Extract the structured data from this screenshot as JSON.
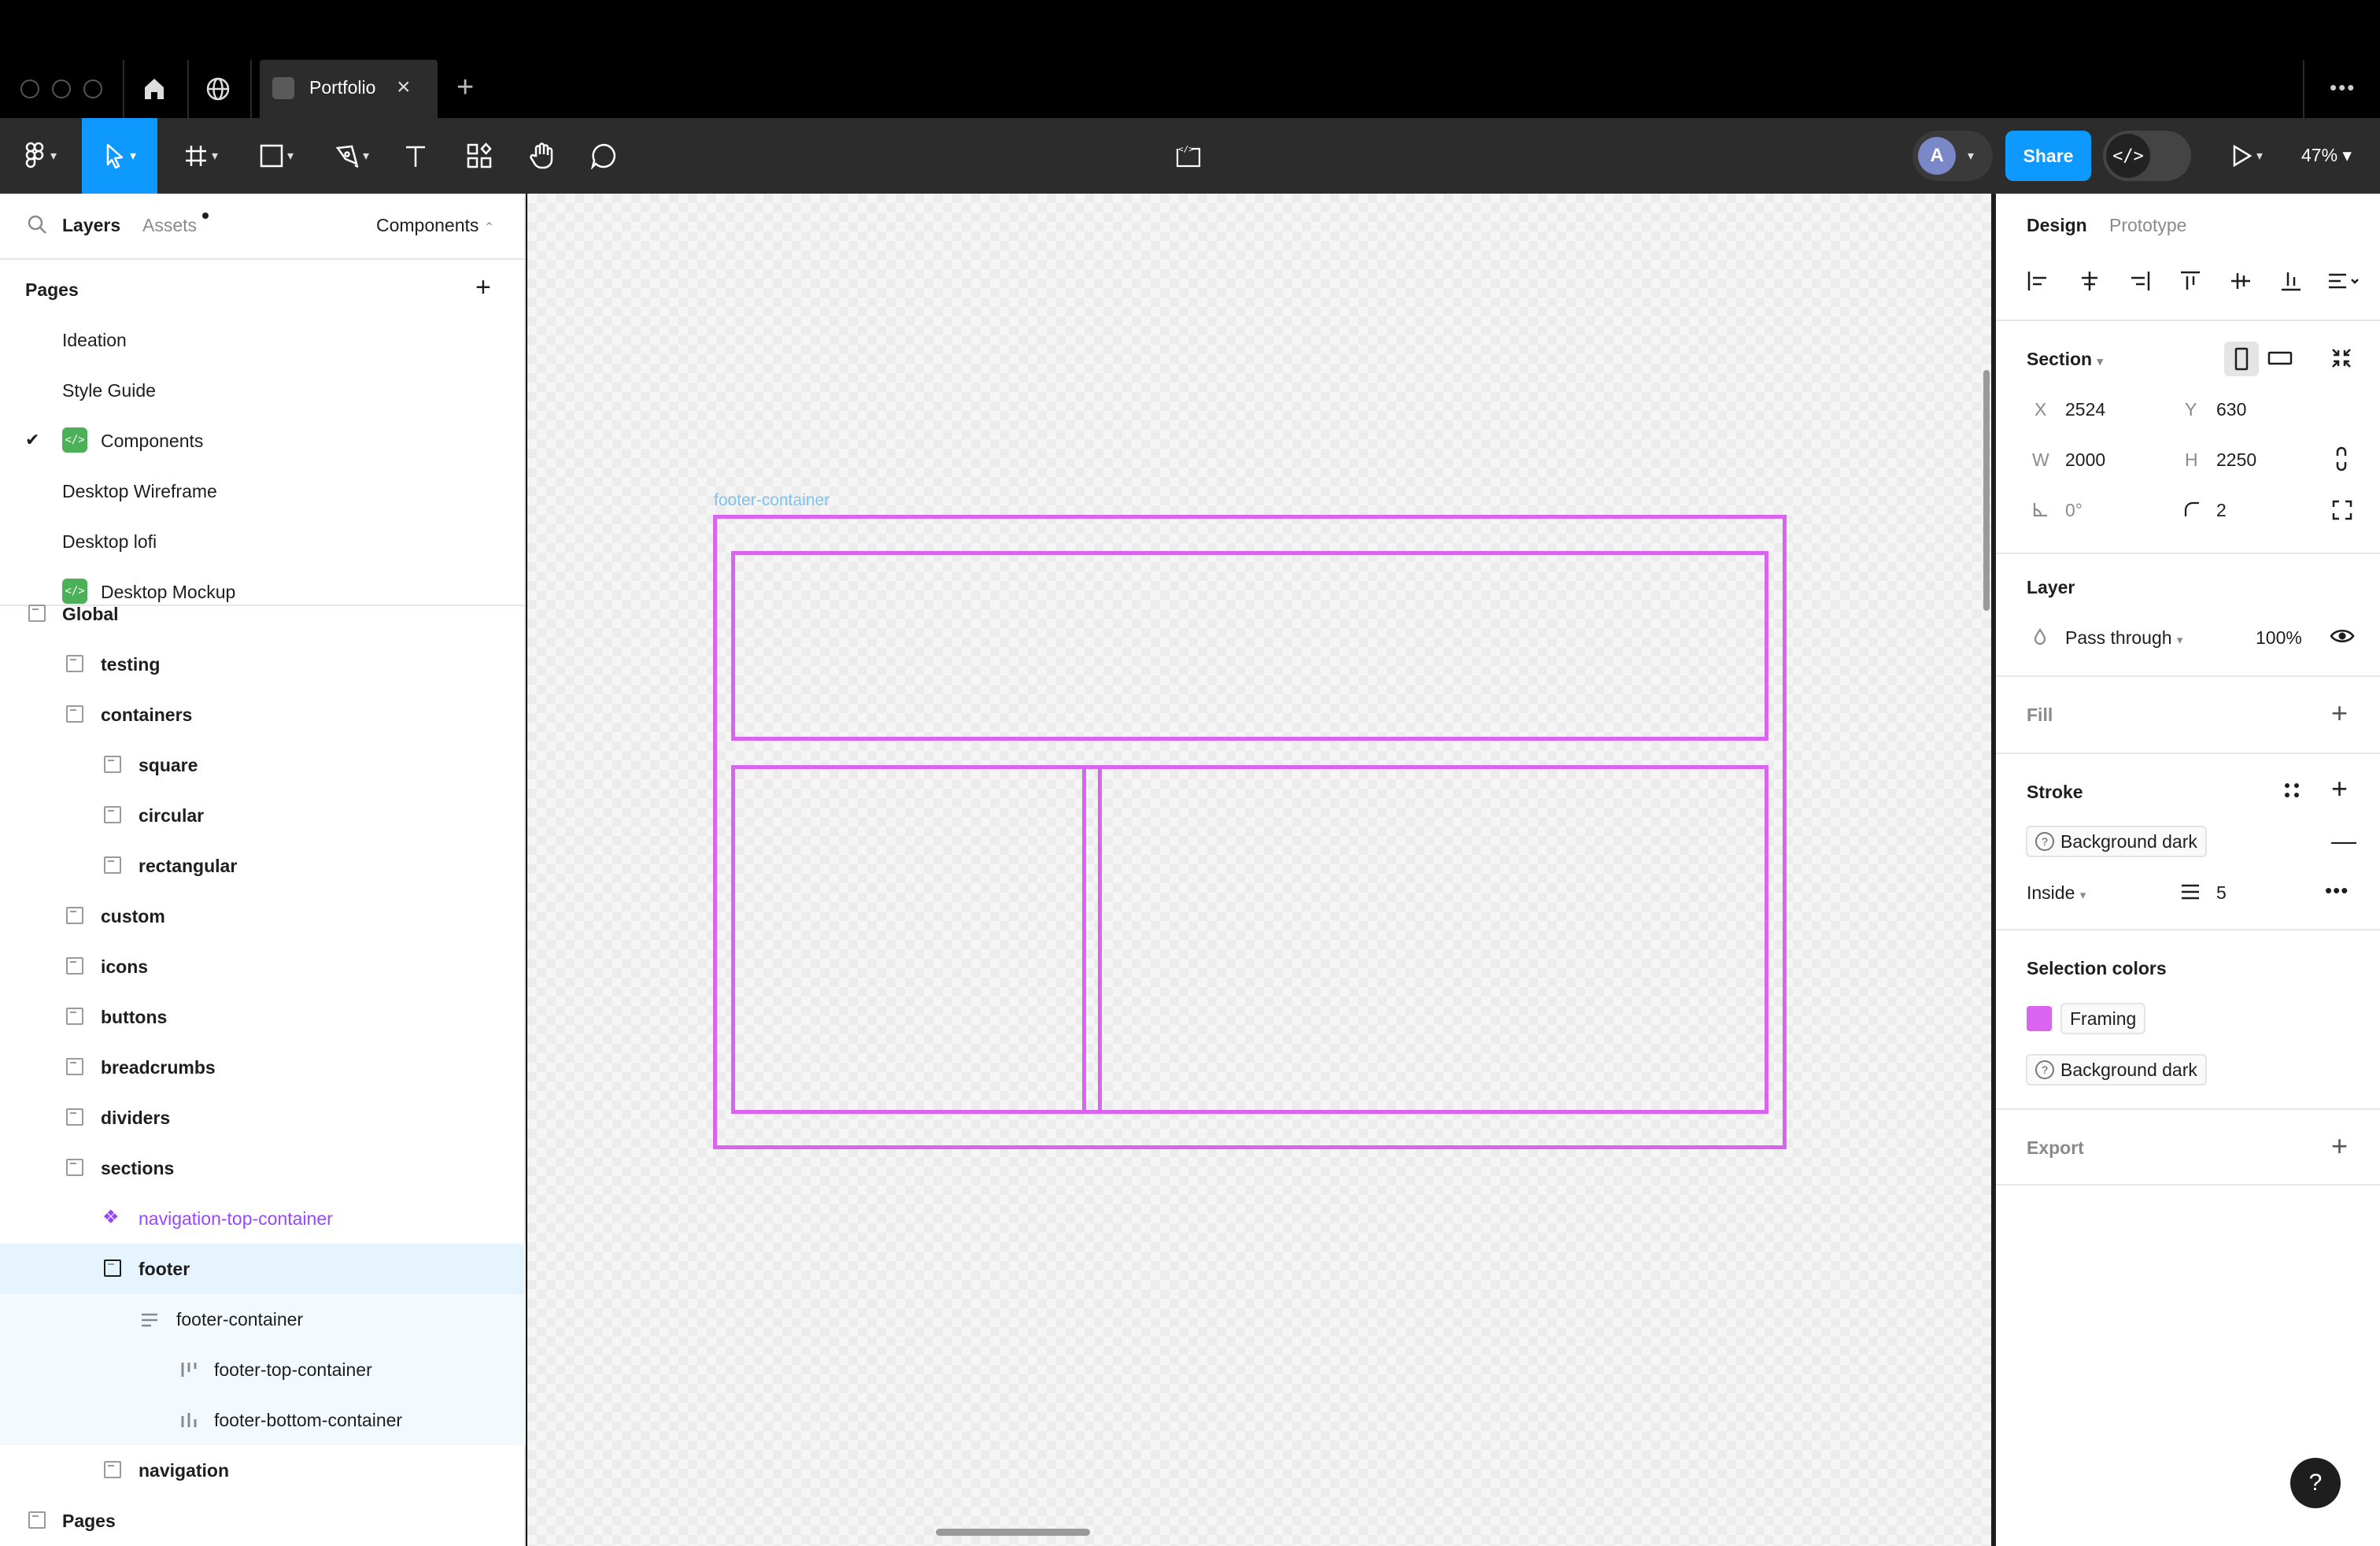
{
  "window": {
    "tab_title": "Portfolio"
  },
  "toolbar": {
    "share_label": "Share",
    "zoom": "47%",
    "avatar_initial": "A",
    "devmode_glyph": "</>"
  },
  "left_panel": {
    "tabs": {
      "layers": "Layers",
      "assets": "Assets"
    },
    "page_selector": "Components",
    "pages_header": "Pages",
    "pages": [
      {
        "label": "Ideation"
      },
      {
        "label": "Style Guide"
      },
      {
        "label": "Components",
        "current": true
      },
      {
        "label": "Desktop Wireframe"
      },
      {
        "label": "Desktop lofi"
      },
      {
        "label": "Desktop Mockup"
      }
    ],
    "layers": [
      {
        "label": "Global"
      },
      {
        "label": "testing"
      },
      {
        "label": "containers"
      },
      {
        "label": "square"
      },
      {
        "label": "circular"
      },
      {
        "label": "rectangular"
      },
      {
        "label": "custom"
      },
      {
        "label": "icons"
      },
      {
        "label": "buttons"
      },
      {
        "label": "breadcrumbs"
      },
      {
        "label": "dividers"
      },
      {
        "label": "sections"
      },
      {
        "label": "navigation-top-container"
      },
      {
        "label": "footer"
      },
      {
        "label": "footer-container"
      },
      {
        "label": "footer-top-container"
      },
      {
        "label": "footer-bottom-container"
      },
      {
        "label": "navigation"
      },
      {
        "label": "Pages"
      }
    ]
  },
  "canvas": {
    "selected_label": "footer-container",
    "frame_color": "#d964f0"
  },
  "right_panel": {
    "tabs": {
      "design": "Design",
      "prototype": "Prototype"
    },
    "section_label": "Section",
    "x_label": "X",
    "x_value": "2524",
    "y_label": "Y",
    "y_value": "630",
    "w_label": "W",
    "w_value": "2000",
    "h_label": "H",
    "h_value": "2250",
    "rotation": "0°",
    "radius": "2",
    "layer_header": "Layer",
    "blend_mode": "Pass through",
    "opacity": "100%",
    "fill_header": "Fill",
    "stroke_header": "Stroke",
    "stroke_style": "Background dark",
    "stroke_position": "Inside",
    "stroke_weight": "5",
    "selection_colors_header": "Selection colors",
    "selection_colors": [
      {
        "label": "Framing",
        "color": "#d964f0"
      },
      {
        "label": "Background dark"
      }
    ],
    "export_header": "Export",
    "help_glyph": "?"
  },
  "colors": {
    "accent": "#0d99ff",
    "frame": "#d964f0",
    "component": "#9747ff",
    "page_icon": "#4bb058"
  }
}
